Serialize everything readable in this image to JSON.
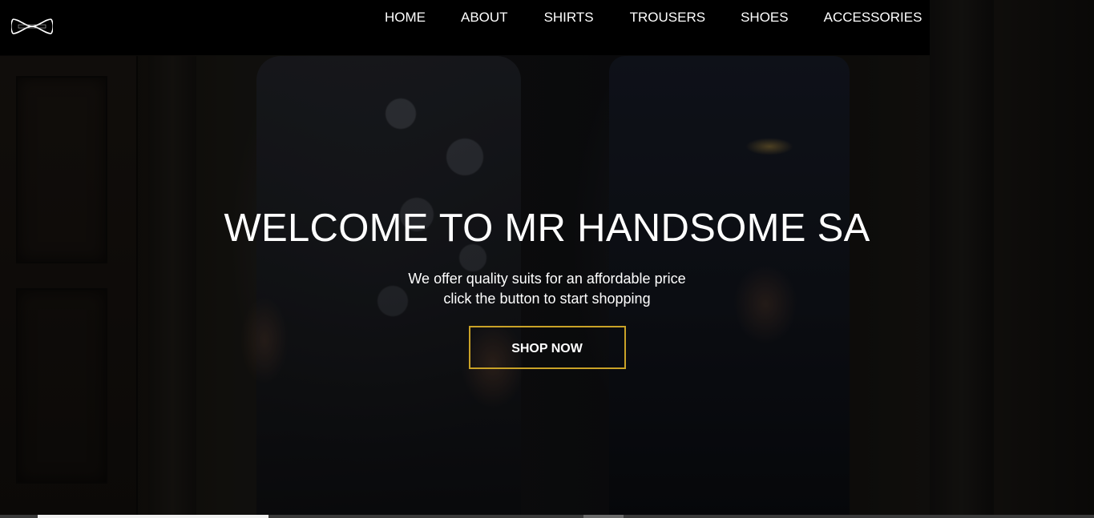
{
  "logo": {
    "icon": "bowtie-icon",
    "alt": "Mr Handsome SA logo"
  },
  "nav": {
    "items": [
      {
        "label": "HOME"
      },
      {
        "label": "ABOUT"
      },
      {
        "label": "SHIRTS"
      },
      {
        "label": "TROUSERS"
      },
      {
        "label": "SHOES"
      },
      {
        "label": "ACCESSORIES"
      }
    ]
  },
  "hero": {
    "title": "WELCOME TO MR HANDSOME SA",
    "subtitle_line1": "We offer quality suits for an affordable price",
    "subtitle_line2": "click the button to start shopping",
    "cta_label": "SHOP NOW"
  },
  "colors": {
    "navbar_bg": "#000000",
    "accent_border": "#c9a227",
    "text": "#ffffff"
  }
}
